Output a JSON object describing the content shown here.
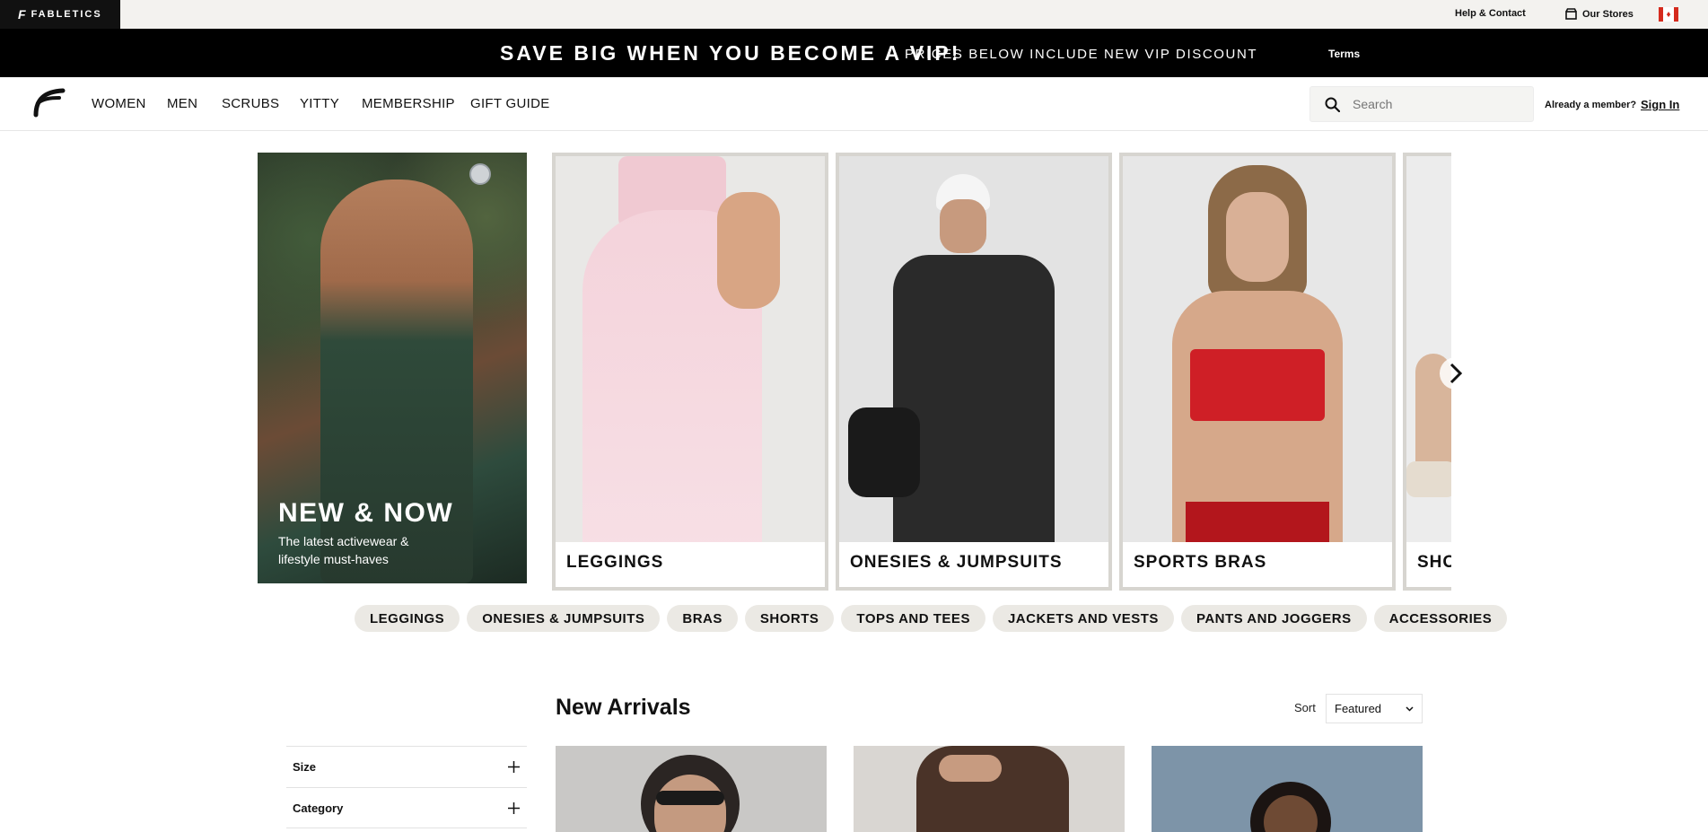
{
  "utility": {
    "brand": "FABLETICS",
    "help_label": "Help & Contact",
    "stores_label": "Our Stores",
    "flag_icon": "canada-flag-icon"
  },
  "promo": {
    "headline": "SAVE BIG WHEN YOU BECOME A VIP!",
    "subtext": "PRICES BELOW INCLUDE NEW VIP DISCOUNT",
    "terms_label": "Terms"
  },
  "nav": {
    "items": [
      "WOMEN",
      "MEN",
      "SCRUBS",
      "YITTY",
      "MEMBERSHIP",
      "GIFT GUIDE"
    ],
    "search_placeholder": "Search",
    "member_prompt": "Already a member?",
    "sign_in_label": "Sign In"
  },
  "hero": {
    "title": "NEW & NOW",
    "subtitle": "The latest activewear & lifestyle must-haves"
  },
  "carousel": {
    "cards": [
      {
        "label": "LEGGINGS"
      },
      {
        "label": "ONESIES & JUMPSUITS"
      },
      {
        "label": "SPORTS BRAS"
      },
      {
        "label": "SHORTS"
      }
    ]
  },
  "chips": [
    "LEGGINGS",
    "ONESIES & JUMPSUITS",
    "BRAS",
    "SHORTS",
    "TOPS AND TEES",
    "JACKETS AND VESTS",
    "PANTS AND JOGGERS",
    "ACCESSORIES"
  ],
  "listing": {
    "title": "New Arrivals",
    "sort_label": "Sort",
    "sort_value": "Featured",
    "filters": [
      {
        "label": "Size"
      },
      {
        "label": "Category"
      }
    ]
  },
  "colors": {
    "promo_bg": "#000000",
    "chip_bg": "#ebe9e4",
    "card_border": "#d7d5d0",
    "utility_bg": "#f3f2ef"
  }
}
